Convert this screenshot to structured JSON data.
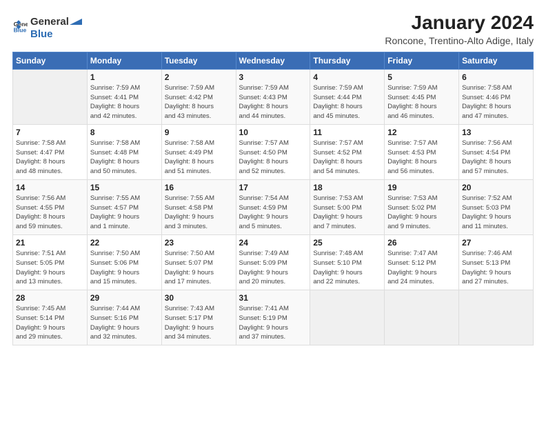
{
  "header": {
    "logo_general": "General",
    "logo_blue": "Blue",
    "month_title": "January 2024",
    "location": "Roncone, Trentino-Alto Adige, Italy"
  },
  "days_of_week": [
    "Sunday",
    "Monday",
    "Tuesday",
    "Wednesday",
    "Thursday",
    "Friday",
    "Saturday"
  ],
  "weeks": [
    [
      {
        "day": "",
        "info": ""
      },
      {
        "day": "1",
        "info": "Sunrise: 7:59 AM\nSunset: 4:41 PM\nDaylight: 8 hours\nand 42 minutes."
      },
      {
        "day": "2",
        "info": "Sunrise: 7:59 AM\nSunset: 4:42 PM\nDaylight: 8 hours\nand 43 minutes."
      },
      {
        "day": "3",
        "info": "Sunrise: 7:59 AM\nSunset: 4:43 PM\nDaylight: 8 hours\nand 44 minutes."
      },
      {
        "day": "4",
        "info": "Sunrise: 7:59 AM\nSunset: 4:44 PM\nDaylight: 8 hours\nand 45 minutes."
      },
      {
        "day": "5",
        "info": "Sunrise: 7:59 AM\nSunset: 4:45 PM\nDaylight: 8 hours\nand 46 minutes."
      },
      {
        "day": "6",
        "info": "Sunrise: 7:58 AM\nSunset: 4:46 PM\nDaylight: 8 hours\nand 47 minutes."
      }
    ],
    [
      {
        "day": "7",
        "info": "Sunrise: 7:58 AM\nSunset: 4:47 PM\nDaylight: 8 hours\nand 48 minutes."
      },
      {
        "day": "8",
        "info": "Sunrise: 7:58 AM\nSunset: 4:48 PM\nDaylight: 8 hours\nand 50 minutes."
      },
      {
        "day": "9",
        "info": "Sunrise: 7:58 AM\nSunset: 4:49 PM\nDaylight: 8 hours\nand 51 minutes."
      },
      {
        "day": "10",
        "info": "Sunrise: 7:57 AM\nSunset: 4:50 PM\nDaylight: 8 hours\nand 52 minutes."
      },
      {
        "day": "11",
        "info": "Sunrise: 7:57 AM\nSunset: 4:52 PM\nDaylight: 8 hours\nand 54 minutes."
      },
      {
        "day": "12",
        "info": "Sunrise: 7:57 AM\nSunset: 4:53 PM\nDaylight: 8 hours\nand 56 minutes."
      },
      {
        "day": "13",
        "info": "Sunrise: 7:56 AM\nSunset: 4:54 PM\nDaylight: 8 hours\nand 57 minutes."
      }
    ],
    [
      {
        "day": "14",
        "info": "Sunrise: 7:56 AM\nSunset: 4:55 PM\nDaylight: 8 hours\nand 59 minutes."
      },
      {
        "day": "15",
        "info": "Sunrise: 7:55 AM\nSunset: 4:57 PM\nDaylight: 9 hours\nand 1 minute."
      },
      {
        "day": "16",
        "info": "Sunrise: 7:55 AM\nSunset: 4:58 PM\nDaylight: 9 hours\nand 3 minutes."
      },
      {
        "day": "17",
        "info": "Sunrise: 7:54 AM\nSunset: 4:59 PM\nDaylight: 9 hours\nand 5 minutes."
      },
      {
        "day": "18",
        "info": "Sunrise: 7:53 AM\nSunset: 5:00 PM\nDaylight: 9 hours\nand 7 minutes."
      },
      {
        "day": "19",
        "info": "Sunrise: 7:53 AM\nSunset: 5:02 PM\nDaylight: 9 hours\nand 9 minutes."
      },
      {
        "day": "20",
        "info": "Sunrise: 7:52 AM\nSunset: 5:03 PM\nDaylight: 9 hours\nand 11 minutes."
      }
    ],
    [
      {
        "day": "21",
        "info": "Sunrise: 7:51 AM\nSunset: 5:05 PM\nDaylight: 9 hours\nand 13 minutes."
      },
      {
        "day": "22",
        "info": "Sunrise: 7:50 AM\nSunset: 5:06 PM\nDaylight: 9 hours\nand 15 minutes."
      },
      {
        "day": "23",
        "info": "Sunrise: 7:50 AM\nSunset: 5:07 PM\nDaylight: 9 hours\nand 17 minutes."
      },
      {
        "day": "24",
        "info": "Sunrise: 7:49 AM\nSunset: 5:09 PM\nDaylight: 9 hours\nand 20 minutes."
      },
      {
        "day": "25",
        "info": "Sunrise: 7:48 AM\nSunset: 5:10 PM\nDaylight: 9 hours\nand 22 minutes."
      },
      {
        "day": "26",
        "info": "Sunrise: 7:47 AM\nSunset: 5:12 PM\nDaylight: 9 hours\nand 24 minutes."
      },
      {
        "day": "27",
        "info": "Sunrise: 7:46 AM\nSunset: 5:13 PM\nDaylight: 9 hours\nand 27 minutes."
      }
    ],
    [
      {
        "day": "28",
        "info": "Sunrise: 7:45 AM\nSunset: 5:14 PM\nDaylight: 9 hours\nand 29 minutes."
      },
      {
        "day": "29",
        "info": "Sunrise: 7:44 AM\nSunset: 5:16 PM\nDaylight: 9 hours\nand 32 minutes."
      },
      {
        "day": "30",
        "info": "Sunrise: 7:43 AM\nSunset: 5:17 PM\nDaylight: 9 hours\nand 34 minutes."
      },
      {
        "day": "31",
        "info": "Sunrise: 7:41 AM\nSunset: 5:19 PM\nDaylight: 9 hours\nand 37 minutes."
      },
      {
        "day": "",
        "info": ""
      },
      {
        "day": "",
        "info": ""
      },
      {
        "day": "",
        "info": ""
      }
    ]
  ]
}
